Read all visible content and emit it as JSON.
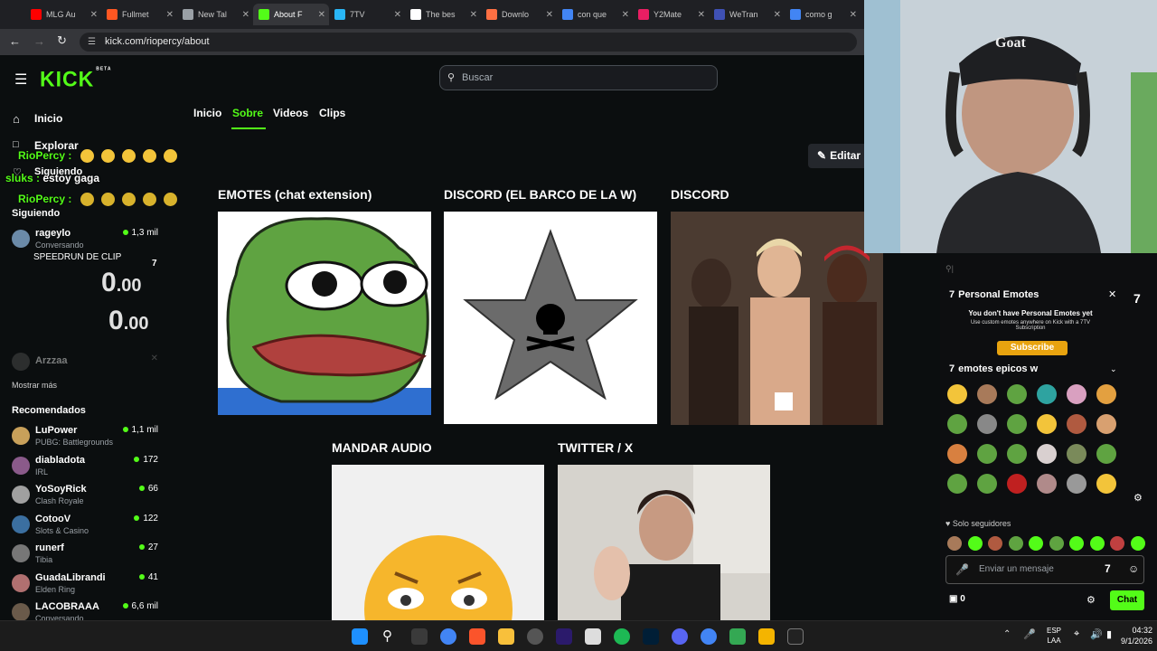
{
  "browser": {
    "tabs": [
      {
        "title": "MLG Au",
        "color": "#ff0000"
      },
      {
        "title": "Fullmet",
        "color": "#ff5722"
      },
      {
        "title": "New Tal",
        "color": "#9aa0a6"
      },
      {
        "title": "About F",
        "color": "#53fc18"
      },
      {
        "title": "7TV",
        "color": "#29b6f6"
      },
      {
        "title": "The bes",
        "color": "#ffffff"
      },
      {
        "title": "Downlo",
        "color": "#ff7043"
      },
      {
        "title": "con que",
        "color": "#4285f4"
      },
      {
        "title": "Y2Mate",
        "color": "#e91e63"
      },
      {
        "title": "WeTran",
        "color": "#3f51b5"
      },
      {
        "title": "como g",
        "color": "#4285f4"
      }
    ],
    "url": "kick.com/riopercy/about"
  },
  "kick": {
    "logo": "KICK",
    "logo_badge": "BETA",
    "search_placeholder": "Buscar",
    "nav": {
      "home": "Inicio",
      "explore": "Explorar",
      "following": "Siguiendo"
    },
    "following_header": "Siguiendo",
    "following": [
      {
        "name": "rageylo",
        "game": "Conversando",
        "viewers": "1,3 mil"
      },
      {
        "name": "Arzzaa",
        "game": "",
        "viewers": ""
      }
    ],
    "show_more": "Mostrar más",
    "recommended_header": "Recomendados",
    "recommended": [
      {
        "name": "LuPower",
        "game": "PUBG: Battlegrounds",
        "viewers": "1,1 mil"
      },
      {
        "name": "diabladota",
        "game": "IRL",
        "viewers": "172"
      },
      {
        "name": "YoSoyRick",
        "game": "Clash Royale",
        "viewers": "66"
      },
      {
        "name": "CotooV",
        "game": "Slots & Casino",
        "viewers": "122"
      },
      {
        "name": "runerf",
        "game": "Tibia",
        "viewers": "27"
      },
      {
        "name": "GuadaLibrandi",
        "game": "Elden Ring",
        "viewers": "41"
      },
      {
        "name": "LACOBRAAA",
        "game": "Conversando",
        "viewers": "6,6 mil"
      }
    ],
    "page_tabs": [
      "Inicio",
      "Sobre",
      "Videos",
      "Clips"
    ],
    "active_tab": "Sobre",
    "edit_button": "Editar",
    "panels": [
      {
        "title": "EMOTES (chat extension)"
      },
      {
        "title": "DISCORD (EL BARCO DE LA W)"
      },
      {
        "title": "DISCORD"
      },
      {
        "title": "MANDAR AUDIO"
      },
      {
        "title": "TWITTER / X"
      }
    ],
    "accent": "#53fc18"
  },
  "overlay": {
    "chat1_user": "RioPercy :",
    "chat2_user": "sluks :",
    "chat2_text": "estoy gaga",
    "chat3_user": "RioPercy :",
    "speedrun_label": "SPEEDRUN DE CLIP",
    "speedrun_num": "7",
    "timer1": "0",
    "timer1_dec": ".00",
    "timer2": "0",
    "timer2_dec": ".00"
  },
  "emotes_panel": {
    "personal_title": "Personal Emotes",
    "personal_msg": "You don't have Personal Emotes yet",
    "personal_sub": "Use custom emotes anywhere on Kick with a 7TV Subscription",
    "subscribe": "Subscribe",
    "set_title": "emotes epicos w",
    "followers_only": "Solo seguidores",
    "message_placeholder": "Enviar un mensaje",
    "points": "0",
    "chat_button": "Chat"
  },
  "taskbar": {
    "lang": "ESP",
    "lang2": "LAA",
    "time": "04:32",
    "date": "9/1/2026"
  }
}
